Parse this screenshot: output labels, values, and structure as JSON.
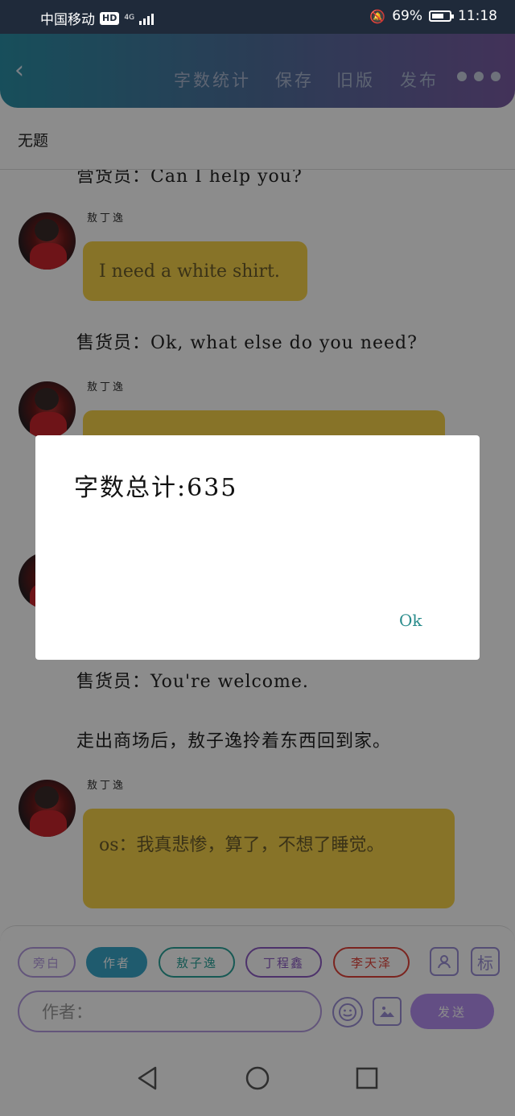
{
  "status_bar": {
    "carrier": "中国移动",
    "hd_badge": "HD",
    "network": "4G",
    "battery_percent": "69%",
    "battery_level": 0.69,
    "time": "11:18",
    "icons": [
      "mute-icon",
      "battery-icon",
      "signal-icon"
    ]
  },
  "app_bar": {
    "back_icon": "back-chevron-icon",
    "word_count": "字数统计",
    "save": "保存",
    "old_version": "旧版",
    "publish": "发布",
    "more_icon": "more-dots-icon",
    "colors": {
      "start": "#2b8fa6",
      "end": "#7a5ca3"
    }
  },
  "document": {
    "title": "无题"
  },
  "script": [
    {
      "type": "line",
      "text": "营货员：Can I help you?"
    },
    {
      "type": "bubble",
      "speaker": "敖丁逸",
      "text": "I need a white shirt."
    },
    {
      "type": "line",
      "text": "售货员：Ok, what else do you need?"
    },
    {
      "type": "bubble",
      "speaker": "敖丁逸",
      "text": ""
    },
    {
      "type": "line",
      "text": "售货员：You're welcome."
    },
    {
      "type": "line",
      "text": "走出商场后，敖子逸拎着东西回到家。"
    },
    {
      "type": "bubble",
      "speaker": "敖丁逸",
      "text": "os：我真悲惨，算了，不想了睡觉。"
    }
  ],
  "toolbar": {
    "chips": [
      {
        "label": "旁白",
        "color": "#b49ce0",
        "active": false
      },
      {
        "label": "作者",
        "color": "#3aa7c9",
        "active": true
      },
      {
        "label": "敖子逸",
        "color": "#2aa39a",
        "active": false
      },
      {
        "label": "丁程鑫",
        "color": "#8c5bc4",
        "active": false
      },
      {
        "label": "李天泽",
        "color": "#e0433a",
        "active": false
      }
    ],
    "person_icon": "person-icon",
    "tag_button": "标",
    "input_placeholder": "作者：",
    "emoji_icon": "emoji-icon",
    "image_icon": "image-icon",
    "send": "发送"
  },
  "nav_bar": {
    "back_icon": "nav-back-icon",
    "home_icon": "nav-home-icon",
    "recents_icon": "nav-recents-icon"
  },
  "dialog": {
    "message": "字数总计:635",
    "ok": "Ok"
  }
}
